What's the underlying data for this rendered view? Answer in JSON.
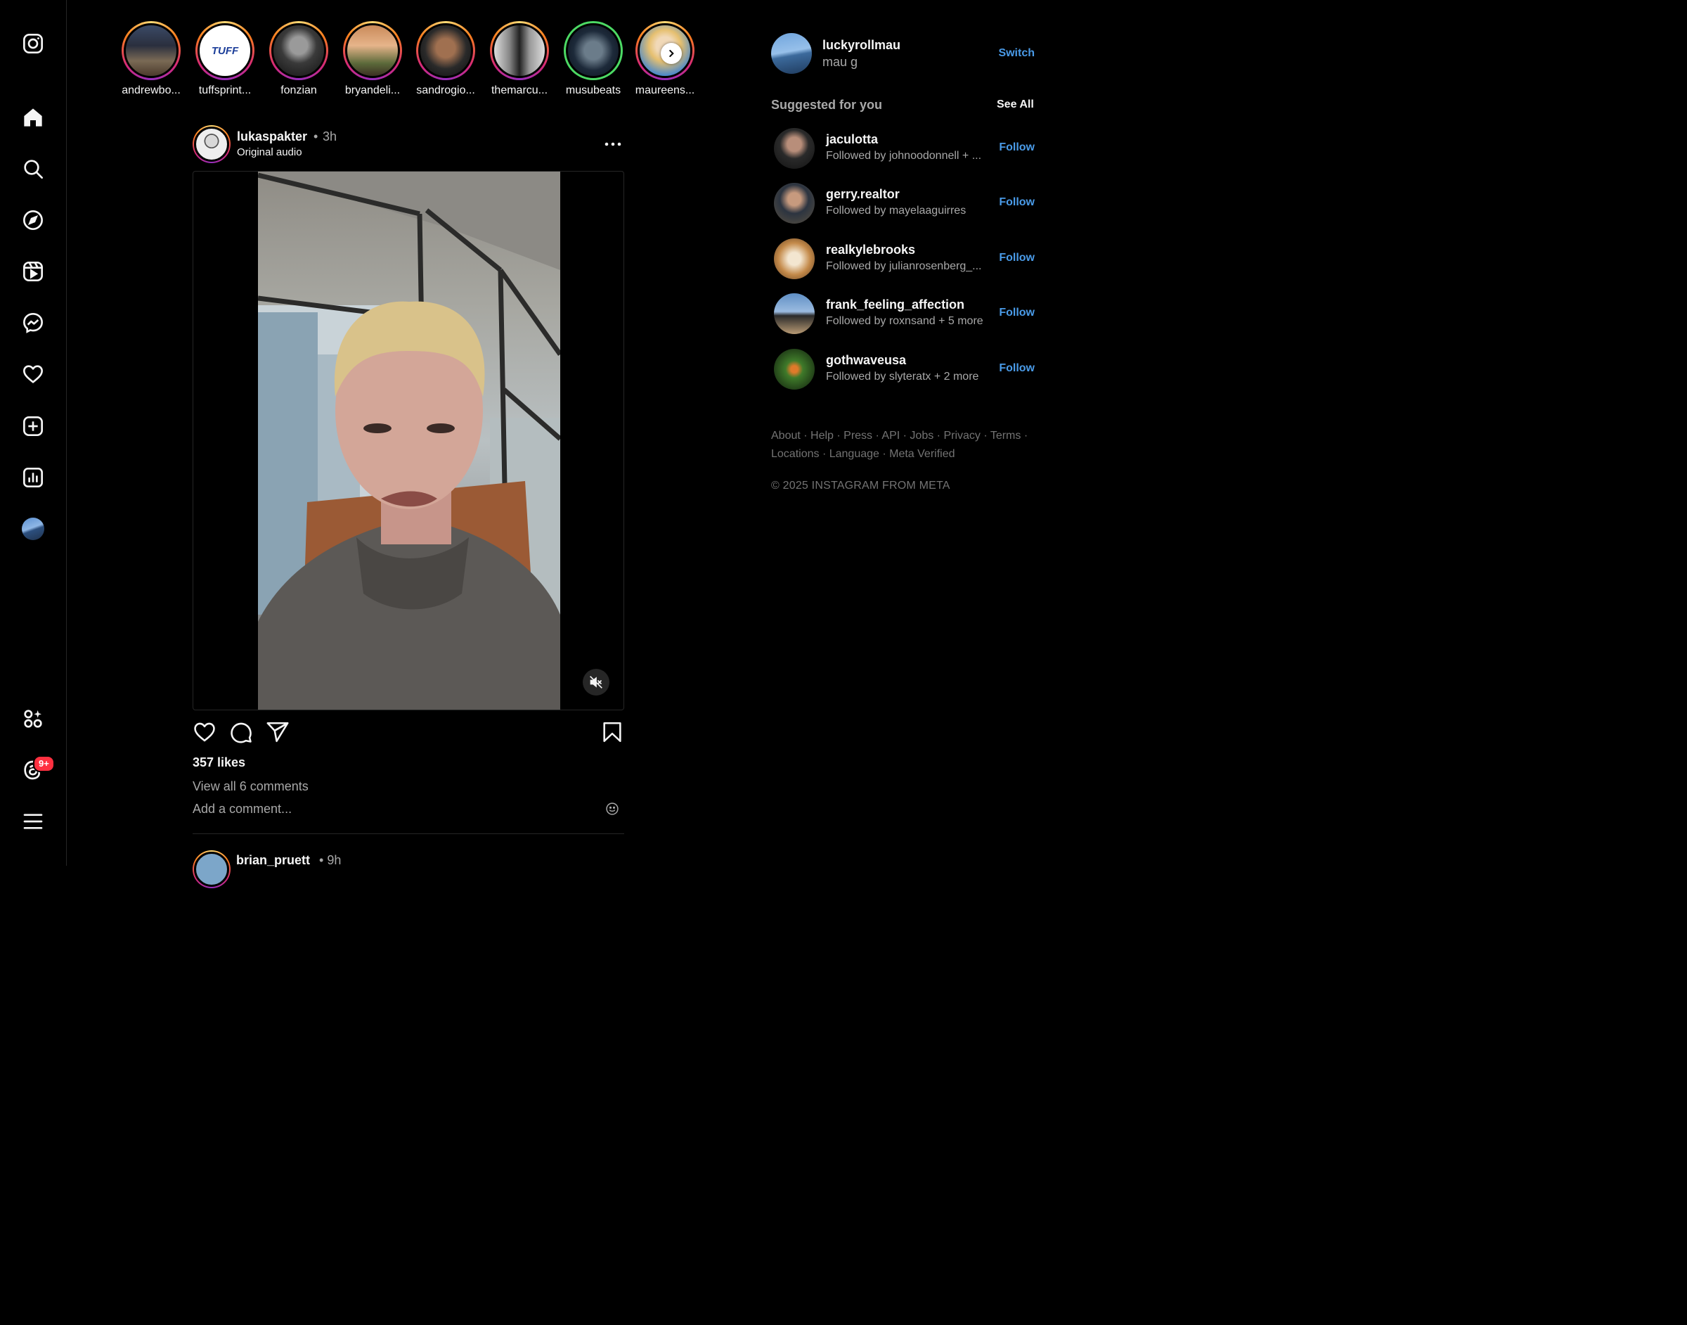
{
  "stories": [
    {
      "name": "andrewbo...",
      "ring": "gradient"
    },
    {
      "name": "tuffsprint...",
      "ring": "gradient",
      "logo_text": "TUFF"
    },
    {
      "name": "fonzian",
      "ring": "gradient"
    },
    {
      "name": "bryandeli...",
      "ring": "gradient"
    },
    {
      "name": "sandrogio...",
      "ring": "gradient"
    },
    {
      "name": "themarcu...",
      "ring": "gradient"
    },
    {
      "name": "musubeats",
      "ring": "green"
    },
    {
      "name": "maureens...",
      "ring": "gradient"
    }
  ],
  "post": {
    "username": "lukaspakter",
    "separator": "•",
    "time": "3h",
    "audio": "Original audio",
    "likes": "357 likes",
    "view_comments": "View all 6 comments",
    "comment_placeholder": "Add a comment..."
  },
  "next_post": {
    "username": "brian_pruett",
    "separator": "•",
    "time": "9h"
  },
  "account": {
    "username": "luckyrollmau",
    "name": "mau g",
    "switch_label": "Switch"
  },
  "suggested": {
    "title": "Suggested for you",
    "see_all": "See All",
    "follow_label": "Follow",
    "items": [
      {
        "username": "jaculotta",
        "subtitle": "Followed by johnoodonnell + ..."
      },
      {
        "username": "gerry.realtor",
        "subtitle": "Followed by mayelaaguirres"
      },
      {
        "username": "realkylebrooks",
        "subtitle": "Followed by julianrosenberg_..."
      },
      {
        "username": "frank_feeling_affection",
        "subtitle": "Followed by roxnsand + 5 more"
      },
      {
        "username": "gothwaveusa",
        "subtitle": "Followed by slyteratx + 2 more"
      }
    ]
  },
  "footer": {
    "links": [
      "About",
      "Help",
      "Press",
      "API",
      "Jobs",
      "Privacy",
      "Terms",
      "Locations",
      "Language",
      "Meta Verified"
    ],
    "copyright": "© 2025 INSTAGRAM FROM META"
  },
  "nav": {
    "notification_badge": "9+"
  },
  "colors": {
    "background": "#000000",
    "link_blue": "#4a9be8",
    "secondary_text": "#a8a8a8",
    "badge_red": "#ff3040",
    "story_ring_green": "#4cd964"
  },
  "icons": [
    "instagram-logo-icon",
    "home-icon",
    "search-icon",
    "explore-icon",
    "reels-icon",
    "messenger-icon",
    "heart-icon",
    "create-icon",
    "dashboard-icon",
    "meta-apps-icon",
    "threads-icon",
    "menu-icon",
    "more-icon",
    "mute-icon",
    "like-icon",
    "comment-icon",
    "share-icon",
    "save-icon",
    "emoji-icon",
    "chevron-right-icon"
  ]
}
